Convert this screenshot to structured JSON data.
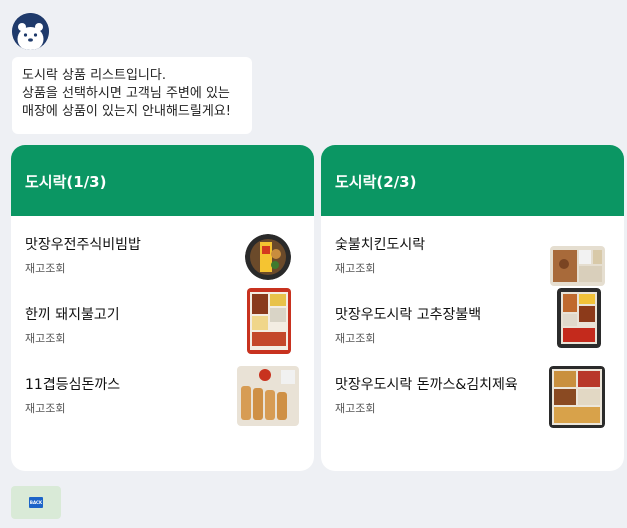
{
  "bot": {
    "avatar_icon": "polar-bear-icon"
  },
  "message": {
    "lines": [
      "도시락 상품 리스트입니다.",
      "상품을 선택하시면 고객님 주변에 있는",
      "매장에 상품이 있는지 안내해드릴게요!"
    ]
  },
  "cards": [
    {
      "title": "도시락(1/3)",
      "items": [
        {
          "name": "맛장우전주식비빔밥",
          "action": "재고조회"
        },
        {
          "name": "한끼 돼지불고기",
          "action": "재고조회"
        },
        {
          "name": "11겹등심돈까스",
          "action": "재고조회"
        }
      ]
    },
    {
      "title": "도시락(2/3)",
      "items": [
        {
          "name": "숯불치킨도시락",
          "action": "재고조회"
        },
        {
          "name": "맛장우도시락 고추장불백",
          "action": "재고조회"
        },
        {
          "name": "맛장우도시락 돈까스&김치제육",
          "action": "재고조회"
        }
      ]
    }
  ],
  "back": {
    "icon": "back-icon",
    "label": "BACK"
  },
  "colors": {
    "header": "#0b9663",
    "background": "#eef0f4",
    "back_button": "#d9ead7"
  }
}
